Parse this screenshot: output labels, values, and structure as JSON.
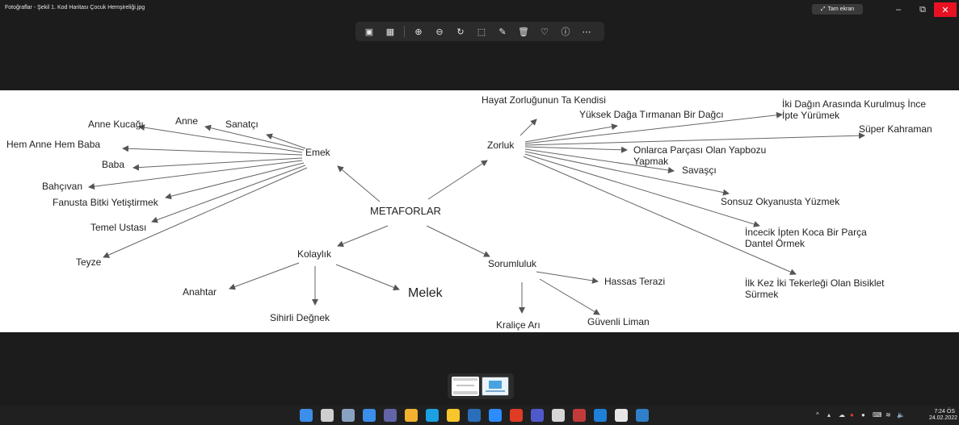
{
  "window": {
    "title": "Fotoğraflar - Şekil 1. Kod Haritası Çocuk Hemşireliği.jpg",
    "fullscreen_label": "Tam ekran",
    "fullscreen_icon": "expand-icon",
    "minimize": "–",
    "restore": "⧉",
    "close": "✕"
  },
  "toolbar": {
    "icons": [
      "gallery-icon",
      "edit-image-icon",
      "zoom-in-icon",
      "zoom-out-icon",
      "rotate-icon",
      "crop-icon",
      "draw-icon",
      "delete-icon",
      "favorite-icon",
      "info-icon",
      "more-icon"
    ],
    "glyphs": [
      "▣",
      "▦",
      "⊕",
      "⊖",
      "↻",
      "⬚",
      "✎",
      "🗑",
      "♡",
      "ⓘ",
      "⋯"
    ]
  },
  "map": {
    "center": "METAFORLAR",
    "emek": "Emek",
    "zorluk": "Zorluk",
    "kolaylik": "Kolaylık",
    "sorumluluk": "Sorumluluk",
    "emek_items": [
      "Anne Kucağı",
      "Anne",
      "Sanatçı",
      "Hem Anne Hem Baba",
      "Baba",
      "Bahçıvan",
      "Fanusta Bitki Yetiştirmek",
      "Temel Ustası",
      "Teyze"
    ],
    "zorluk_items": [
      "Hayat Zorluğunun Ta Kendisi",
      "Yüksek Dağa Tırmanan Bir Dağcı",
      "İki Dağın Arasında Kurulmuş İnce",
      "İpte Yürümek",
      "Süper Kahraman",
      "Onlarca Parçası Olan Yapbozu",
      "Yapmak",
      "Savaşçı",
      "Sonsuz Okyanusta Yüzmek",
      "İncecik İpten Koca Bir Parça",
      "Dantel Örmek",
      "İlk Kez İki Tekerleği Olan Bisiklet",
      "Sürmek"
    ],
    "kolaylik_items": [
      "Anahtar",
      "Sihirli Değnek",
      "Melek"
    ],
    "sorumluluk_items": [
      "Hassas Terazi",
      "Kraliçe Arı",
      "Güvenli Liman"
    ]
  },
  "filmstrip": [
    "thumbnail-current",
    "thumbnail-anne"
  ],
  "taskbar": {
    "apps": [
      "windows-start-icon",
      "search-icon",
      "task-view-icon",
      "widgets-icon",
      "chat-icon",
      "chrome-icon",
      "edge-icon",
      "file-explorer-icon",
      "calculator-icon",
      "zoom-icon",
      "office-icon",
      "teams-icon",
      "language-app-icon",
      "calendar-icon",
      "help-icon",
      "mail-icon",
      "photos-icon"
    ],
    "app_colors": [
      "#3b8eea",
      "#cfcfcf",
      "#8aa2c2",
      "#3b8eea",
      "#6264a7",
      "#f2b230",
      "#1ba1e2",
      "#f8c62c",
      "#2a6ebb",
      "#2d8cff",
      "#e03b24",
      "#5059c9",
      "#d6d6d6",
      "#c23b3b",
      "#1f80d8",
      "#e6e6e6",
      "#2f7fc9"
    ],
    "tray_arrow": "^",
    "time": "7:24 ÖS",
    "date": "24.02.2022"
  },
  "colors": {
    "background": "#1c1c1c",
    "close_red": "#e81123",
    "arrow": "#555555"
  }
}
